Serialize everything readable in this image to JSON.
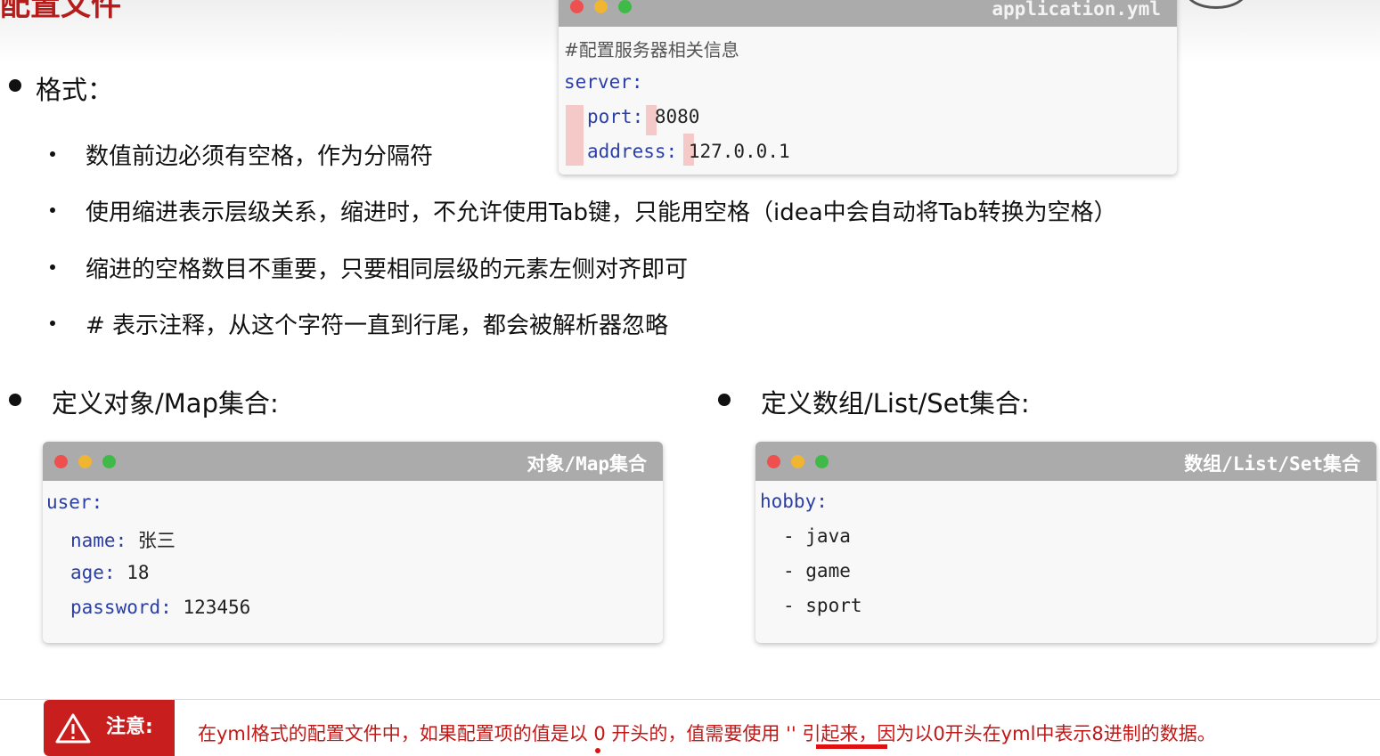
{
  "title_fragment": "配置文件",
  "format": {
    "heading": "格式：",
    "items": [
      "数值前边必须有空格，作为分隔符",
      "使用缩进表示层级关系，缩进时，不允许使用Tab键，只能用空格（idea中会自动将Tab转换为空格）",
      "缩进的空格数目不重要，只要相同层级的元素左侧对齐即可",
      "#  表示注释，从这个字符一直到行尾，都会被解析器忽略"
    ]
  },
  "app_window": {
    "title": "application.yml",
    "comment": "#配置服务器相关信息",
    "root_key": "server:",
    "lines": [
      {
        "key": "port:",
        "value": "8080"
      },
      {
        "key": "address:",
        "value": "127.0.0.1"
      }
    ]
  },
  "object_section": {
    "heading": "定义对象/Map集合:",
    "window_title": "对象/Map集合",
    "root_key": "user:",
    "lines": [
      {
        "key": "name:",
        "value": "张三"
      },
      {
        "key": "age:",
        "value": "18"
      },
      {
        "key": "password:",
        "value": "123456"
      }
    ]
  },
  "array_section": {
    "heading": "定义数组/List/Set集合:",
    "window_title": "数组/List/Set集合",
    "root_key": "hobby:",
    "items": [
      "- java",
      "- game",
      "- sport"
    ]
  },
  "note": {
    "label": "注意:",
    "text": "在yml格式的配置文件中，如果配置项的值是以 0 开头的，值需要使用 '' 引起来，因为以0开头在yml中表示8进制的数据。"
  },
  "colors": {
    "accent_red": "#c81e1e",
    "yaml_key": "#2c3fa8",
    "window_bar": "#ababab"
  },
  "icons": [
    "warning-icon",
    "window-close-dot",
    "window-minimize-dot",
    "window-maximize-dot"
  ]
}
